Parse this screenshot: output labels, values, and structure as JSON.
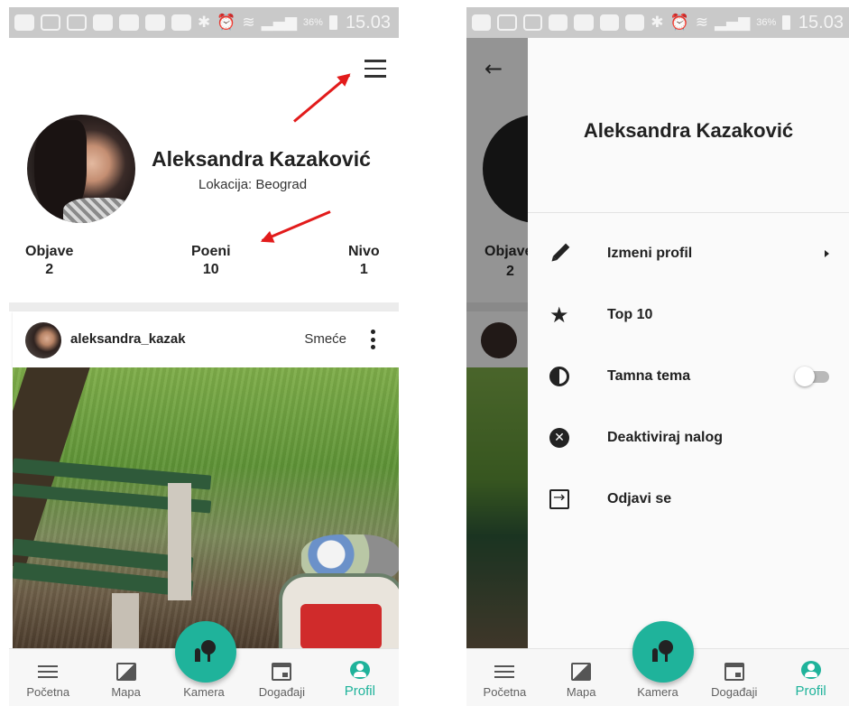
{
  "status_bar": {
    "battery": "36%",
    "time": "15.03"
  },
  "profile": {
    "name": "Aleksandra Kazaković",
    "location": "Lokacija: Beograd",
    "stats": [
      {
        "label": "Objave",
        "value": "2"
      },
      {
        "label": "Poeni",
        "value": "10"
      },
      {
        "label": "Nivo",
        "value": "1"
      }
    ]
  },
  "post": {
    "username": "aleksandra_kazak",
    "category": "Smeće"
  },
  "bottom_nav": {
    "items": [
      {
        "label": "Početna",
        "icon": "list-icon"
      },
      {
        "label": "Mapa",
        "icon": "image-icon"
      },
      {
        "label": "Kamera",
        "icon": "camera-tree-icon"
      },
      {
        "label": "Događaji",
        "icon": "calendar-icon"
      },
      {
        "label": "Profil",
        "icon": "account-circle-icon"
      }
    ],
    "active": "Profil"
  },
  "drawer": {
    "name": "Aleksandra Kazaković",
    "items": [
      {
        "label": "Izmeni profil",
        "icon": "pencil-icon"
      },
      {
        "label": "Top 10",
        "icon": "star-icon"
      },
      {
        "label": "Tamna tema",
        "icon": "contrast-icon"
      },
      {
        "label": "Deaktiviraj nalog",
        "icon": "cancel-icon"
      },
      {
        "label": "Odjavi se",
        "icon": "logout-icon"
      }
    ],
    "dark_theme_enabled": false
  },
  "colors": {
    "accent": "#1fb39b",
    "annotation": "#e21b1b"
  }
}
